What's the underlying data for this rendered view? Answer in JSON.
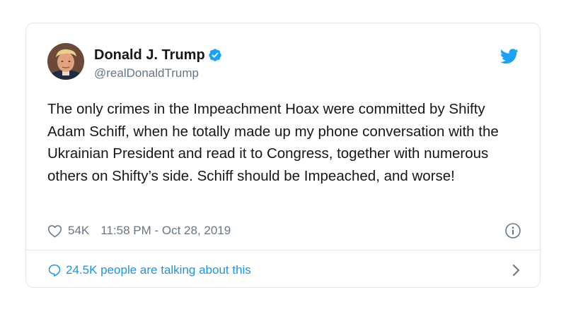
{
  "tweet": {
    "author": {
      "display_name": "Donald J. Trump",
      "handle": "@realDonaldTrump",
      "verified": true
    },
    "text": "The only crimes in the Impeachment Hoax were committed by Shifty Adam Schiff, when he totally made up my phone conversation with the Ukrainian President and read it to Congress, together with numerous others on Shifty’s side. Schiff should be Impeached, and worse!",
    "likes": "54K",
    "timestamp": "11:58 PM - Oct 28, 2019",
    "talking_about": "24.5K people are talking about this"
  },
  "icons": {
    "avatar": "avatar-photo",
    "verified": "verified-badge-icon",
    "brand": "twitter-bird-icon",
    "like": "heart-icon",
    "info": "info-icon",
    "reply": "speech-bubble-icon",
    "more": "chevron-right-icon"
  },
  "colors": {
    "accent": "#1DA1F2",
    "link": "#1B95E0",
    "text_primary": "#14171A",
    "text_secondary": "#657786",
    "border": "#E1E8ED"
  }
}
